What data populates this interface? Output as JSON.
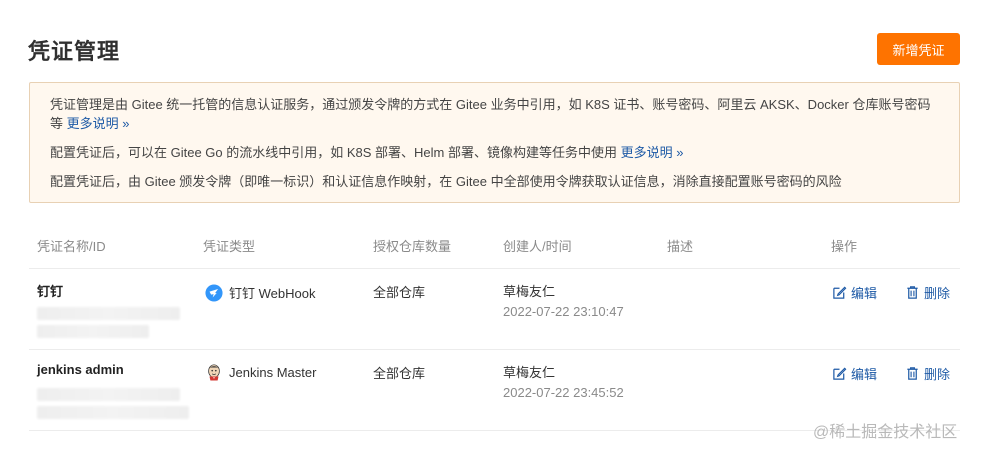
{
  "page": {
    "title": "凭证管理",
    "add_button": "新增凭证"
  },
  "notice": {
    "line1": "凭证管理是由 Gitee 统一托管的信息认证服务，通过颁发令牌的方式在 Gitee 业务中引用，如 K8S 证书、账号密码、阿里云 AKSK、Docker 仓库账号密码等",
    "line1_link": "更多说明 »",
    "line2": "配置凭证后，可以在 Gitee Go 的流水线中引用，如 K8S 部署、Helm 部署、镜像构建等任务中使用",
    "line2_link": "更多说明 »",
    "line3": "配置凭证后，由 Gitee 颁发令牌（即唯一标识）和认证信息作映射，在 Gitee 中全部使用令牌获取认证信息，消除直接配置账号密码的风险"
  },
  "table": {
    "headers": [
      "凭证名称/ID",
      "凭证类型",
      "授权仓库数量",
      "创建人/时间",
      "描述",
      "操作"
    ],
    "rows": [
      {
        "name": "钉钉",
        "type": "钉钉 WebHook",
        "type_icon": "dingtalk-icon",
        "repos": "全部仓库",
        "creator": "草梅友仁",
        "time": "2022-07-22 23:10:47",
        "desc": "",
        "edit": "编辑",
        "delete": "删除"
      },
      {
        "name": "jenkins admin",
        "type": "Jenkins Master",
        "type_icon": "jenkins-icon",
        "repos": "全部仓库",
        "creator": "草梅友仁",
        "time": "2022-07-22 23:45:52",
        "desc": "",
        "edit": "编辑",
        "delete": "删除"
      }
    ]
  },
  "watermark": "@稀土掘金技术社区",
  "colors": {
    "accent": "#fe7300",
    "link": "#1e5aa6",
    "notice_bg": "#fff8ef",
    "notice_border": "#e8d1b4"
  }
}
